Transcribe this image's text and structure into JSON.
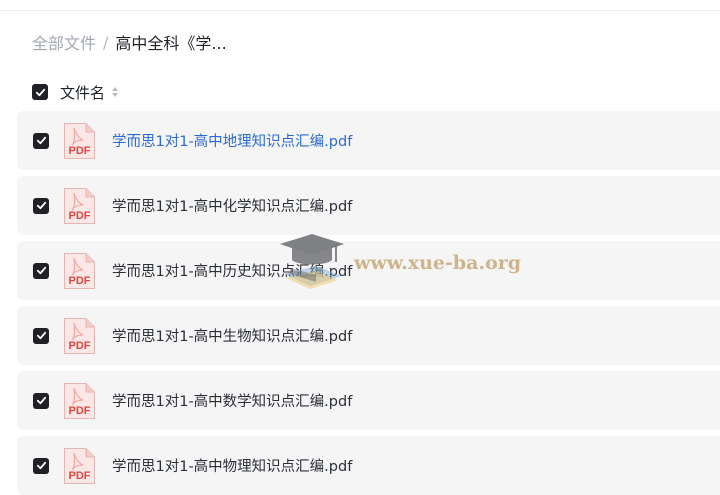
{
  "breadcrumb": {
    "root": "全部文件",
    "separator": "/",
    "current": "高中全科《学..."
  },
  "header": {
    "column_label": "文件名",
    "sort_icon": "sort-icon",
    "select_all_checked": true
  },
  "files": [
    {
      "name": "学而思1对1-高中地理知识点汇编.pdf",
      "checked": true,
      "active": true,
      "icon": "pdf-icon",
      "icon_label": "PDF"
    },
    {
      "name": "学而思1对1-高中化学知识点汇编.pdf",
      "checked": true,
      "active": false,
      "icon": "pdf-icon",
      "icon_label": "PDF"
    },
    {
      "name": "学而思1对1-高中历史知识点汇编.pdf",
      "checked": true,
      "active": false,
      "icon": "pdf-icon",
      "icon_label": "PDF"
    },
    {
      "name": "学而思1对1-高中生物知识点汇编.pdf",
      "checked": true,
      "active": false,
      "icon": "pdf-icon",
      "icon_label": "PDF"
    },
    {
      "name": "学而思1对1-高中数学知识点汇编.pdf",
      "checked": true,
      "active": false,
      "icon": "pdf-icon",
      "icon_label": "PDF"
    },
    {
      "name": "学而思1对1-高中物理知识点汇编.pdf",
      "checked": true,
      "active": false,
      "icon": "pdf-icon",
      "icon_label": "PDF"
    }
  ],
  "watermark": {
    "text": "www.xue-ba.org",
    "icon": "graduation-cap-icon"
  },
  "colors": {
    "link_blue": "#2a6ad6",
    "checkbox": "#1f2124",
    "row_background": "#f5f5f6",
    "pdf_red": "#e0463f"
  }
}
